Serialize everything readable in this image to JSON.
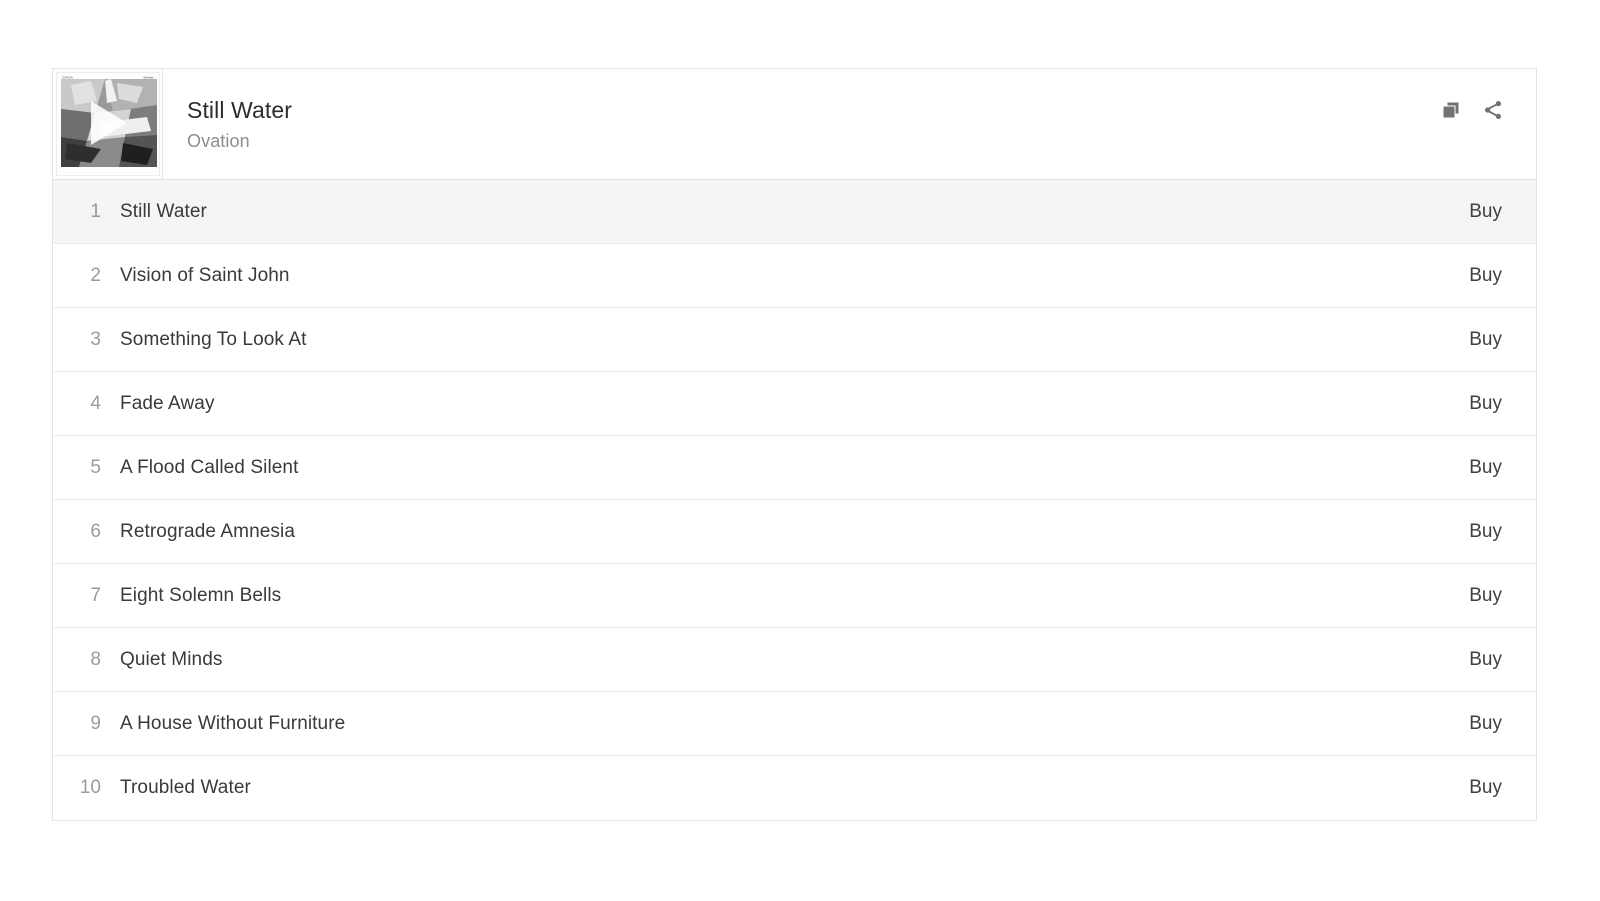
{
  "colors": {
    "page_background": "#ffffff",
    "card_border": "#e4e4e4",
    "row_divider": "#e9e9e9",
    "active_row_background": "#f5f5f5",
    "title_text": "#2c2c2c",
    "artist_text": "#8d8d8d",
    "track_number_text": "#9b9b9b",
    "track_title_text": "#3a3a3a",
    "buy_link_text": "#3f3f3f",
    "icon_color": "#737373"
  },
  "header": {
    "album_title": "Still Water",
    "artist_name": "Ovation",
    "artwork": {
      "label": "album-artwork",
      "play_button_label": "play-album",
      "caption_left": "OVATION",
      "caption_right": "Still Water"
    },
    "actions": [
      {
        "name": "copy-icon",
        "label": "Copy"
      },
      {
        "name": "share-icon",
        "label": "Share"
      }
    ]
  },
  "tracks": [
    {
      "number": "1",
      "title": "Still Water",
      "buy_label": "Buy",
      "active": true
    },
    {
      "number": "2",
      "title": "Vision of Saint John",
      "buy_label": "Buy",
      "active": false
    },
    {
      "number": "3",
      "title": "Something To Look At",
      "buy_label": "Buy",
      "active": false
    },
    {
      "number": "4",
      "title": "Fade Away",
      "buy_label": "Buy",
      "active": false
    },
    {
      "number": "5",
      "title": "A Flood Called Silent",
      "buy_label": "Buy",
      "active": false
    },
    {
      "number": "6",
      "title": "Retrograde Amnesia",
      "buy_label": "Buy",
      "active": false
    },
    {
      "number": "7",
      "title": "Eight Solemn Bells",
      "buy_label": "Buy",
      "active": false
    },
    {
      "number": "8",
      "title": "Quiet Minds",
      "buy_label": "Buy",
      "active": false
    },
    {
      "number": "9",
      "title": "A House Without Furniture",
      "buy_label": "Buy",
      "active": false
    },
    {
      "number": "10",
      "title": "Troubled Water",
      "buy_label": "Buy",
      "active": false
    }
  ]
}
